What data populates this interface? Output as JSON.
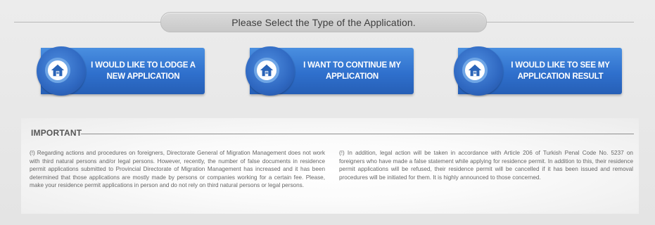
{
  "header": {
    "title": "Please Select the Type of the Application."
  },
  "actions": [
    {
      "label": "I WOULD LIKE TO LODGE A NEW APPLICATION",
      "icon": "house-icon"
    },
    {
      "label": "I WANT TO CONTINUE MY APPLICATION",
      "icon": "house-icon"
    },
    {
      "label": "I WOULD LIKE TO SEE MY APPLICATION RESULT",
      "icon": "house-icon"
    }
  ],
  "important": {
    "title": "IMPORTANT",
    "left_text": "(!) Regarding actions and procedures on foreigners, Directorate General of Migration Management does not work with third natural persons and/or legal persons. However, recently, the number of false documents in residence permit applications submitted to Provincial Directorate of Migration Management has increased and it has been determined that those applications are mostly made by persons or companies working for a certain fee. Please, make your residence permit applications in person and do not rely on third natural persons or legal persons.",
    "right_text": "(!) In addition, legal action will be taken in accordance with Article 206 of Turkish Penal Code No. 5237 on foreigners who have made a false statement while applying for residence permit. In addition to this, their residence permit applications will be refused, their residence permit will be cancelled if it has been issued and removal procedures will be initiated for them. It is highly announced to those concerned."
  },
  "colors": {
    "button_blue": "#2f70cd",
    "header_pill": "#d2d2d2",
    "text_gray": "#666666"
  }
}
